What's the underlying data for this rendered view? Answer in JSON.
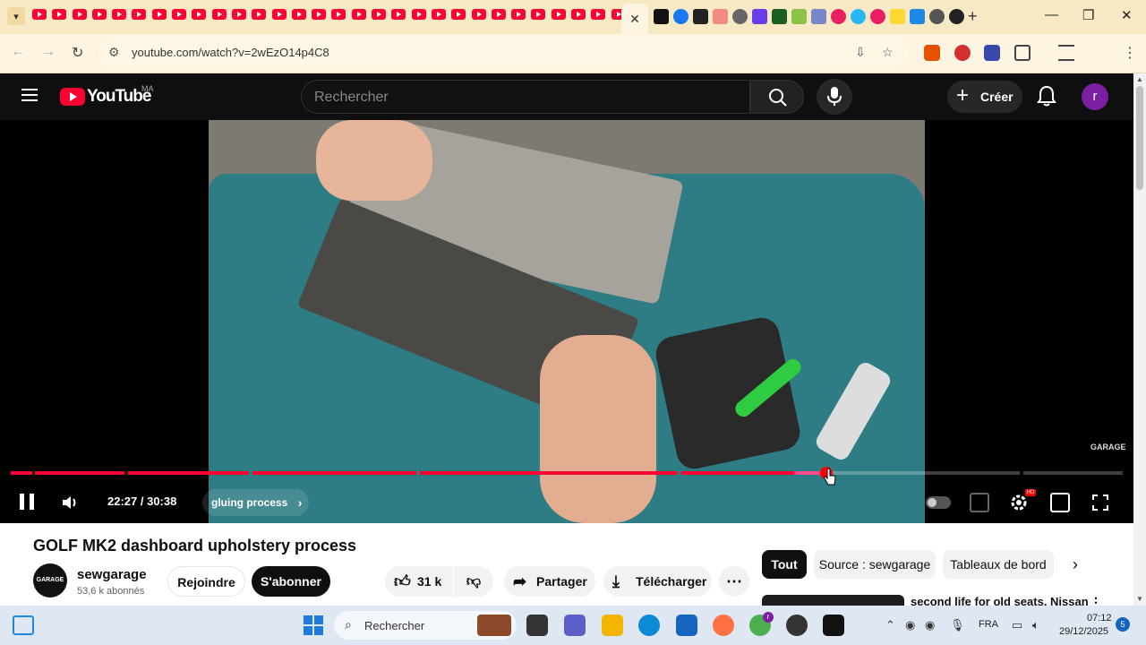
{
  "browser": {
    "url": "youtube.com/watch?v=2wEzO14p4C8",
    "profile_initial": "r",
    "extension_badge": "5",
    "tab_icons": [
      "yt",
      "yt",
      "yt",
      "yt",
      "yt",
      "yt",
      "yt",
      "yt",
      "yt",
      "yt",
      "m",
      "yt",
      "yt",
      "yt",
      "yt",
      "yt",
      "yt",
      "yt",
      "gmail",
      "yt",
      "yt",
      "yt",
      "yt",
      "yt",
      "yt",
      "yt",
      "yt",
      "yt",
      "yt",
      "yt",
      "yt"
    ],
    "active_tab_close": "✕"
  },
  "youtube": {
    "logo_text": "YouTube",
    "region": "MA",
    "search_placeholder": "Rechercher",
    "create_label": "Créer",
    "avatar_initial": "r"
  },
  "player": {
    "current_time": "22:27",
    "duration": "30:38",
    "time_display": "22:27 / 30:38",
    "chapter": "gluing process",
    "progress_fraction": 0.733,
    "watermark": "GARAGE",
    "accent": "#ff0033"
  },
  "video": {
    "title": "GOLF MK2 dashboard upholstery process",
    "channel_name": "sewgarage",
    "channel_avatar_text": "GARAGE",
    "subscribers": "53,6 k abonnés",
    "join_label": "Rejoindre",
    "subscribe_label": "S'abonner",
    "likes": "31 k",
    "share_label": "Partager",
    "download_label": "Télécharger"
  },
  "chips": {
    "items": [
      "Tout",
      "Source : sewgarage",
      "Tableaux de bord"
    ],
    "active": "Tout"
  },
  "recommendation": {
    "title": "second life for old seats. Nissan"
  },
  "taskbar": {
    "search_placeholder": "Rechercher",
    "language": "FRA",
    "time": "07:12",
    "date": "29/12/2025",
    "notification_count": "5",
    "chrome_badge": "r"
  }
}
